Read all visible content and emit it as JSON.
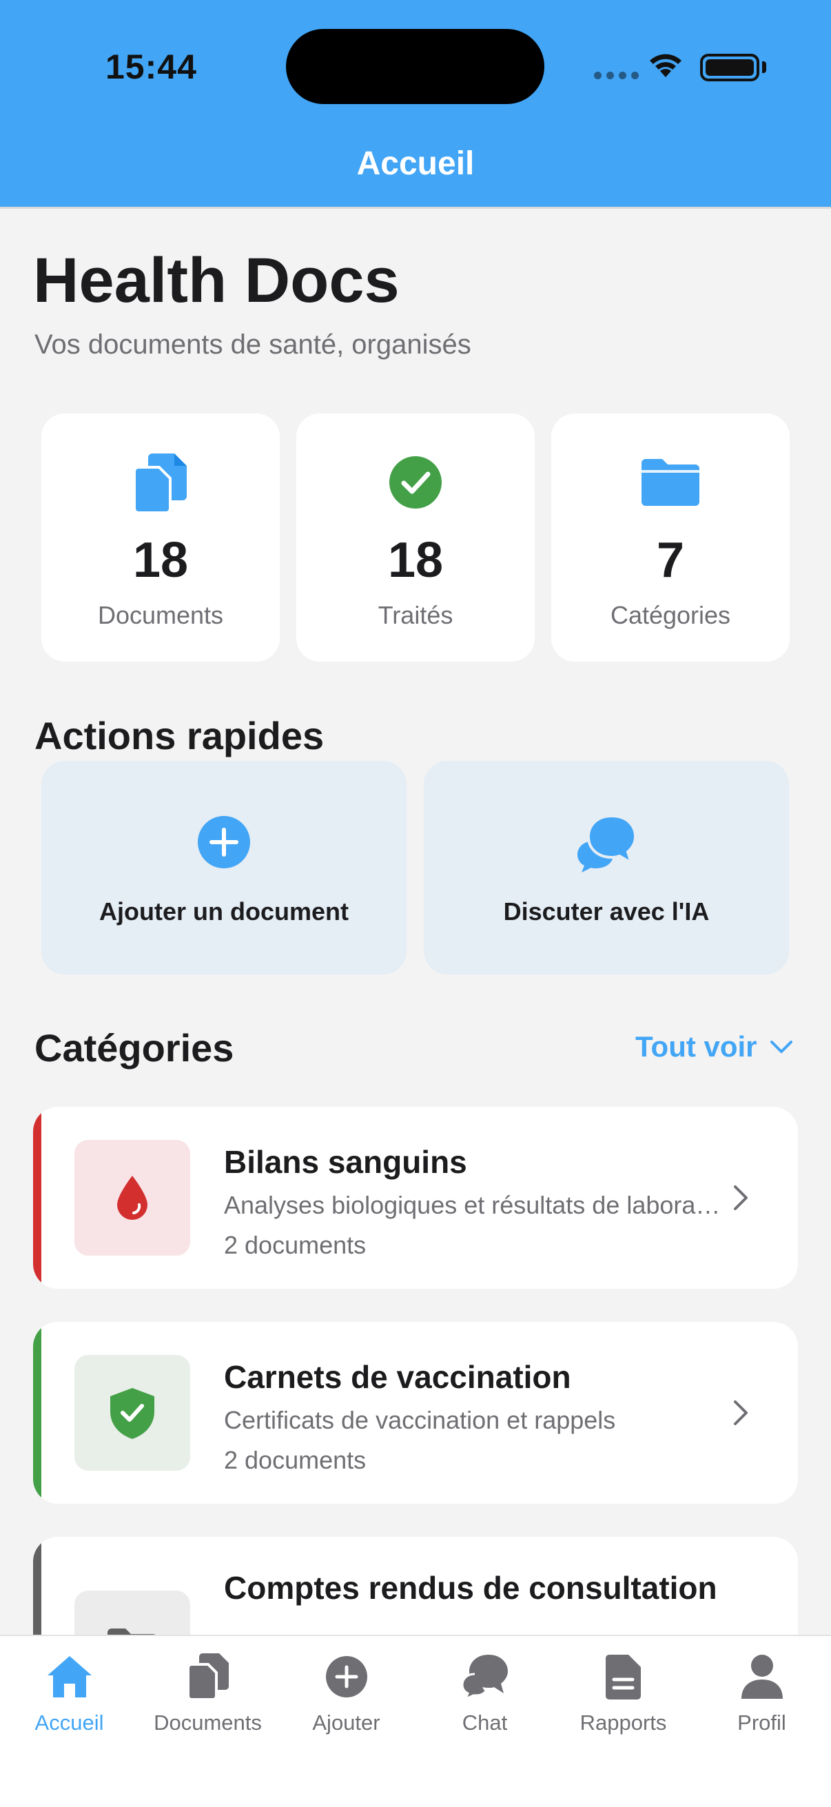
{
  "status_bar": {
    "time": "15:44"
  },
  "nav": {
    "title": "Accueil"
  },
  "hero": {
    "title": "Health Docs",
    "subtitle": "Vos documents de santé, organisés"
  },
  "stats": [
    {
      "icon": "documents-icon",
      "value": "18",
      "label": "Documents",
      "color": "#42a5f5"
    },
    {
      "icon": "check-circle-icon",
      "value": "18",
      "label": "Traités",
      "color": "#43a047"
    },
    {
      "icon": "folder-icon",
      "value": "7",
      "label": "Catégories",
      "color": "#42a5f5"
    }
  ],
  "quick_actions": {
    "title": "Actions rapides",
    "items": [
      {
        "icon": "plus-circle-icon",
        "label": "Ajouter un document"
      },
      {
        "icon": "chat-bubbles-icon",
        "label": "Discuter avec l'IA"
      }
    ]
  },
  "categories": {
    "title": "Catégories",
    "see_all": "Tout voir",
    "items": [
      {
        "icon": "blood-drop-icon",
        "name": "Bilans sanguins",
        "description": "Analyses biologiques et résultats de laboratoire",
        "count": "2 documents",
        "color": "#d32f2f",
        "bg": "#f8e4e6"
      },
      {
        "icon": "shield-check-icon",
        "name": "Carnets de vaccination",
        "description": "Certificats de vaccination et rappels",
        "count": "2 documents",
        "color": "#43a047",
        "bg": "#e8efe8"
      },
      {
        "icon": "folder-icon",
        "name": "Comptes rendus de consultation",
        "description": "",
        "count": "",
        "color": "#616161",
        "bg": "#ececec"
      }
    ]
  },
  "tabbar": [
    {
      "icon": "home-icon",
      "label": "Accueil",
      "active": true
    },
    {
      "icon": "documents-icon",
      "label": "Documents",
      "active": false
    },
    {
      "icon": "plus-circle-icon",
      "label": "Ajouter",
      "active": false
    },
    {
      "icon": "chat-icon",
      "label": "Chat",
      "active": false
    },
    {
      "icon": "report-icon",
      "label": "Rapports",
      "active": false
    },
    {
      "icon": "person-icon",
      "label": "Profil",
      "active": false
    }
  ],
  "colors": {
    "accent": "#42a5f5",
    "background": "#f3f3f3",
    "tab_inactive": "#6e6e73"
  }
}
